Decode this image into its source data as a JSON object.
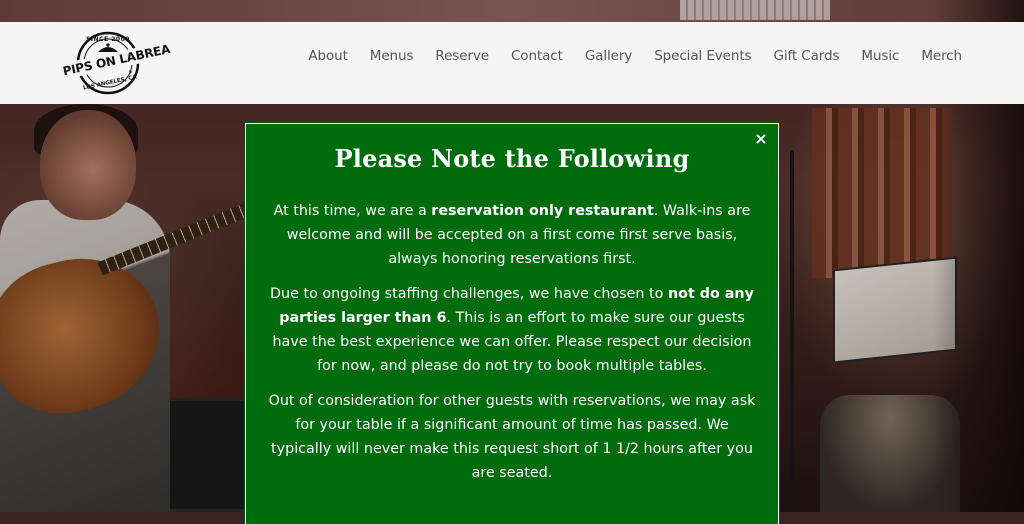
{
  "header": {
    "logo": {
      "name": "PIPS ON LABREA",
      "since": "SINCE 2009",
      "city": "LOS ANGELES, CA"
    },
    "nav": [
      {
        "label": "About"
      },
      {
        "label": "Menus"
      },
      {
        "label": "Reserve"
      },
      {
        "label": "Contact"
      },
      {
        "label": "Gallery"
      },
      {
        "label": "Special Events"
      },
      {
        "label": "Gift Cards"
      },
      {
        "label": "Music"
      },
      {
        "label": "Merch"
      }
    ]
  },
  "modal": {
    "close_label": "×",
    "title": "Please Note the Following",
    "p1": {
      "pre": "At this time, we are a ",
      "bold": "reservation only restaurant",
      "post": ". Walk-ins are welcome and will be accepted on a first come first serve basis, always honoring reservations first."
    },
    "p2": {
      "pre": "Due to ongoing staffing challenges, we have chosen to ",
      "bold": "not do any parties larger than 6",
      "post": ". This is an effort to make sure our guests have the best experience we can offer. Please respect our decision for now, and please do not try to book multiple tables."
    },
    "p3": "Out of consideration for other guests with reservations, we may ask for your table if a significant amount of time has passed. We typically will never make this request short of 1 1/2 hours after you are seated."
  },
  "colors": {
    "modal_bg": "#016c0d",
    "header_bg": "#f5f5f5",
    "nav_text": "#555555"
  }
}
